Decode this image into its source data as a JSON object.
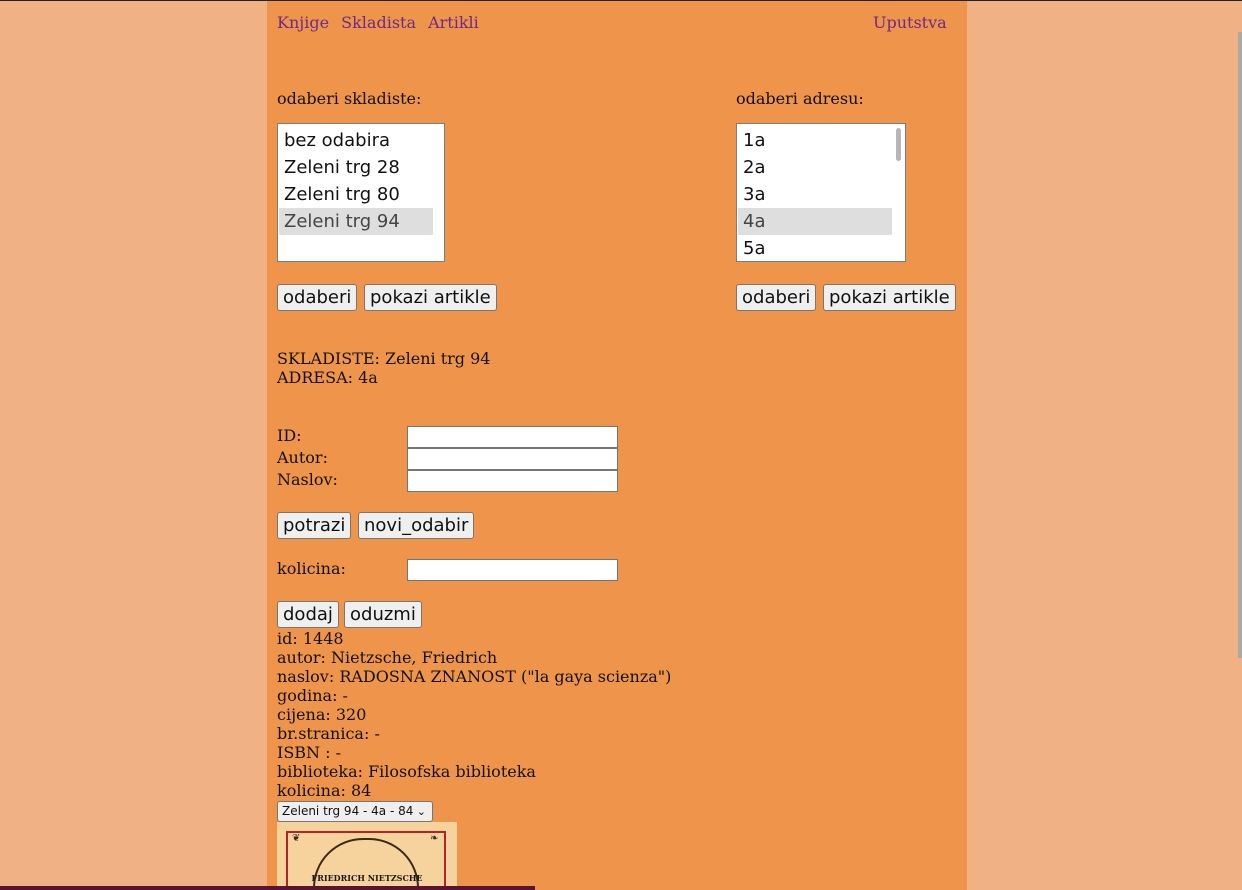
{
  "nav": {
    "links": [
      "Knjige",
      "Skladista",
      "Artikli"
    ],
    "help": "Uputstva"
  },
  "warehouse": {
    "label": "odaberi skladiste:",
    "options": [
      "bez odabira",
      "Zeleni trg 28",
      "Zeleni trg 80",
      "Zeleni trg 94"
    ],
    "selected": "Zeleni trg 94",
    "choose_button": "odaberi",
    "show_button": "pokazi artikle"
  },
  "address": {
    "label": "odaberi adresu:",
    "options": [
      "1a",
      "2a",
      "3a",
      "4a",
      "5a"
    ],
    "selected": "4a",
    "choose_button": "odaberi",
    "show_button": "pokazi artikle"
  },
  "current": {
    "warehouse": "SKLADISTE: Zeleni trg 94",
    "address": "ADRESA: 4a"
  },
  "search": {
    "id_label": "ID:",
    "autor_label": "Autor:",
    "naslov_label": "Naslov:",
    "id_value": "",
    "autor_value": "",
    "naslov_value": "",
    "search_button": "potrazi",
    "reset_button": "novi_odabir"
  },
  "quantity": {
    "label": "kolicina:",
    "value": "",
    "add_button": "dodaj",
    "remove_button": "oduzmi"
  },
  "article": {
    "id": "id: 1448",
    "autor": "autor: Nietzsche, Friedrich",
    "naslov": "naslov: RADOSNA ZNANOST (\"la gaya scienza\")",
    "godina": "godina: -",
    "cijena": "cijena: 320",
    "stranica": "br.stranica: -",
    "isbn": "ISBN : -",
    "biblioteka": "biblioteka: Filosofska biblioteka",
    "kolicina": "kolicina: 84",
    "location_select": "Zeleni trg 94 - 4a - 84",
    "cover_text": "FRIEDRICH NIETZSCHE"
  }
}
